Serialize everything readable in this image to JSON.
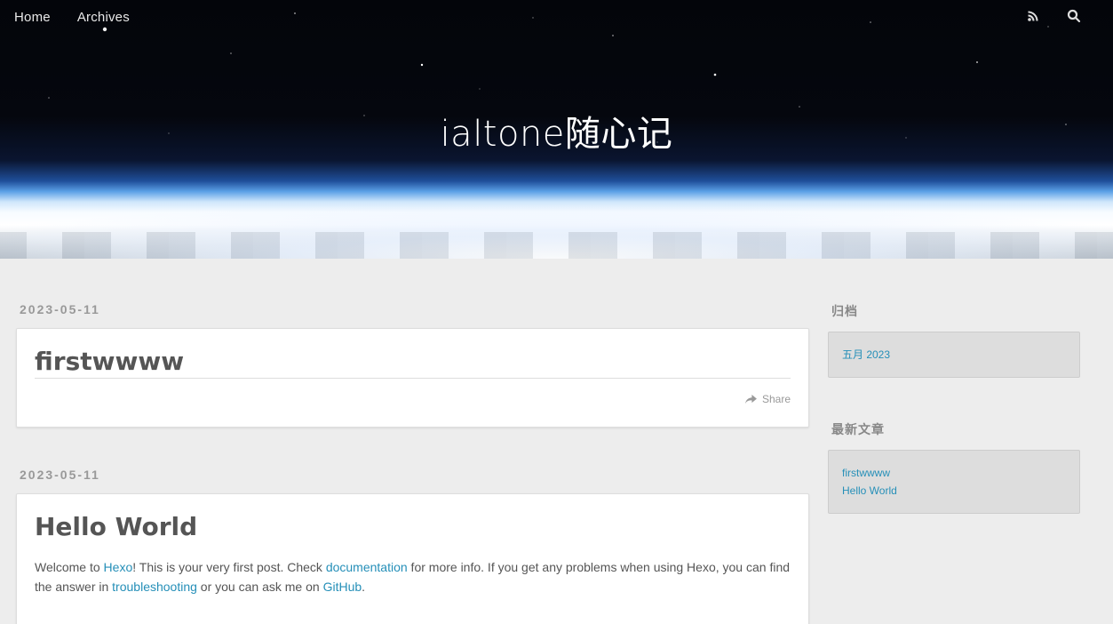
{
  "nav": {
    "items": [
      "Home",
      "Archives"
    ],
    "icons": [
      "rss-icon",
      "search-icon"
    ]
  },
  "site": {
    "title": "ialtone随心记"
  },
  "posts": [
    {
      "date": "2023-05-11",
      "title": "firstwwww",
      "share": "Share"
    },
    {
      "date": "2023-05-11",
      "title": "Hello World",
      "body": {
        "t1": "Welcome to ",
        "l1": "Hexo",
        "t2": "! This is your very first post. Check ",
        "l2": "documentation",
        "t3": " for more info. If you get any problems when using Hexo, you can find the answer in ",
        "l3": "troubleshooting",
        "t4": " or you can ask me on ",
        "l4": "GitHub",
        "t5": "."
      }
    }
  ],
  "sidebar": {
    "archive_title": "归档",
    "archive_items": [
      "五月 2023"
    ],
    "recent_title": "最新文章",
    "recent_items": [
      "firstwwww",
      "Hello World"
    ]
  },
  "colors": {
    "link": "#258fb8",
    "background": "#ededed"
  }
}
